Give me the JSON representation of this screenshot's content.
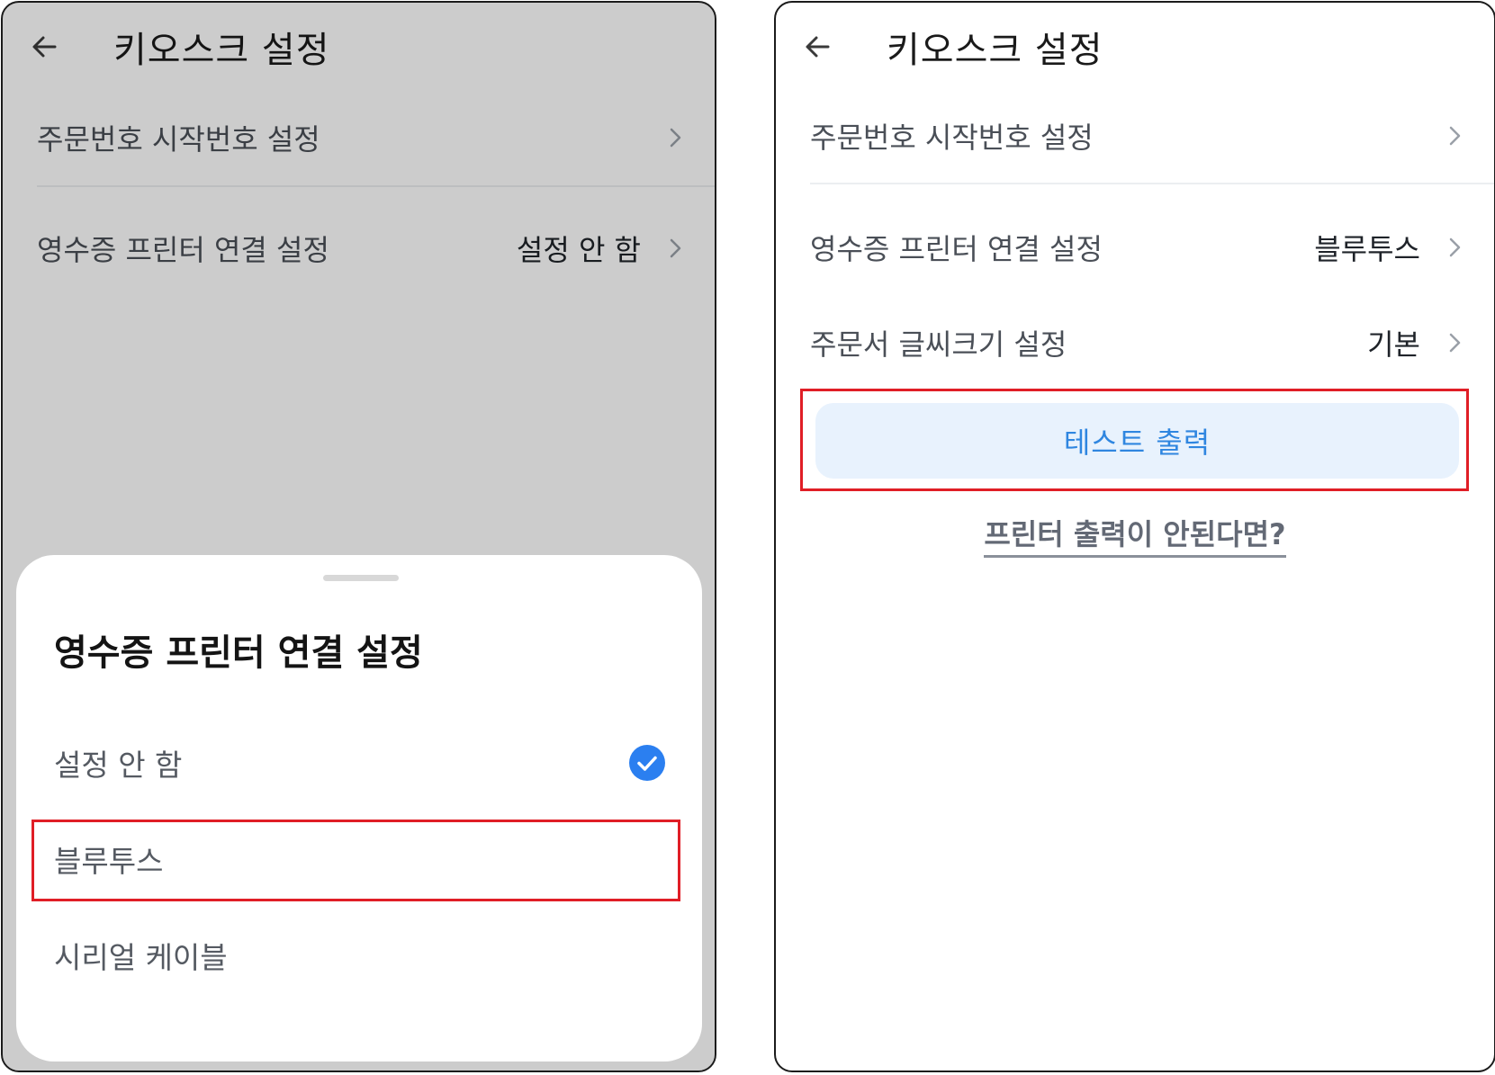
{
  "left_screen": {
    "header": {
      "back_icon": "arrow-left-icon",
      "title": "키오스크 설정"
    },
    "rows": [
      {
        "label": "주문번호 시작번호 설정",
        "value": ""
      },
      {
        "label": "영수증 프린터 연결 설정",
        "value": "설정 안 함"
      }
    ],
    "sheet": {
      "title": "영수증 프린터 연결 설정",
      "options": [
        {
          "label": "설정 안 함",
          "selected": true
        },
        {
          "label": "블루투스",
          "selected": false
        },
        {
          "label": "시리얼 케이블",
          "selected": false
        }
      ]
    }
  },
  "right_screen": {
    "header": {
      "back_icon": "arrow-left-icon",
      "title": "키오스크 설정"
    },
    "rows": [
      {
        "label": "주문번호 시작번호 설정",
        "value": ""
      },
      {
        "label": "영수증 프린터 연결 설정",
        "value": "블루투스"
      },
      {
        "label": "주문서 글씨크기 설정",
        "value": "기본"
      }
    ],
    "test_button_label": "테스트 출력",
    "help_link_label": "프린터 출력이 안된다면?"
  },
  "colors": {
    "accent_blue": "#2f86e0",
    "check_blue": "#2b7ff0",
    "highlight_red": "#e01e26",
    "button_bg": "#e8f2fd"
  }
}
